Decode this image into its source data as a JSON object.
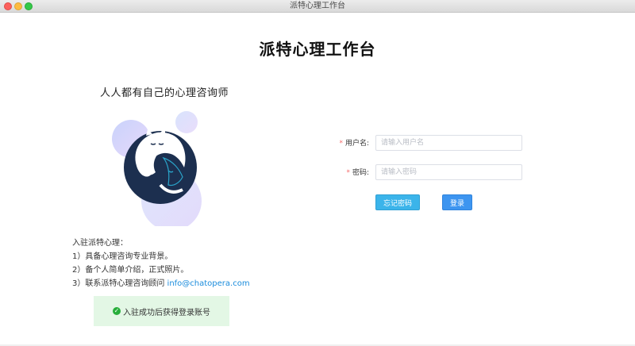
{
  "window": {
    "title": "派特心理工作台"
  },
  "header": {
    "title": "派特心理工作台"
  },
  "left": {
    "slogan": "人人都有自己的心理咨询师",
    "info_heading": "入驻派特心理：",
    "info_lines": [
      "1）具备心理咨询专业背景。",
      "2）备个人简单介绍，正式照片。"
    ],
    "contact_prefix": "3）联系派特心理咨询顾问 ",
    "contact_email": "info@chatopera.com",
    "notice": "入驻成功后获得登录账号",
    "notice_icon": "check-circle-icon"
  },
  "form": {
    "required_mark": "*",
    "username_label": "用户名:",
    "username_placeholder": "请输入用户名",
    "username_value": "",
    "password_label": "密码:",
    "password_placeholder": "请输入密码",
    "password_value": "",
    "forgot_label": "忘记密码",
    "login_label": "登录"
  },
  "colors": {
    "accent": "#3d95f0",
    "forgot_button": "#3bb4ea",
    "link": "#1a8cdc",
    "notice_bg": "#e3f7e5",
    "success": "#27ae3a",
    "required": "#f56c6c",
    "logo_dark": "#1c2f4f"
  }
}
